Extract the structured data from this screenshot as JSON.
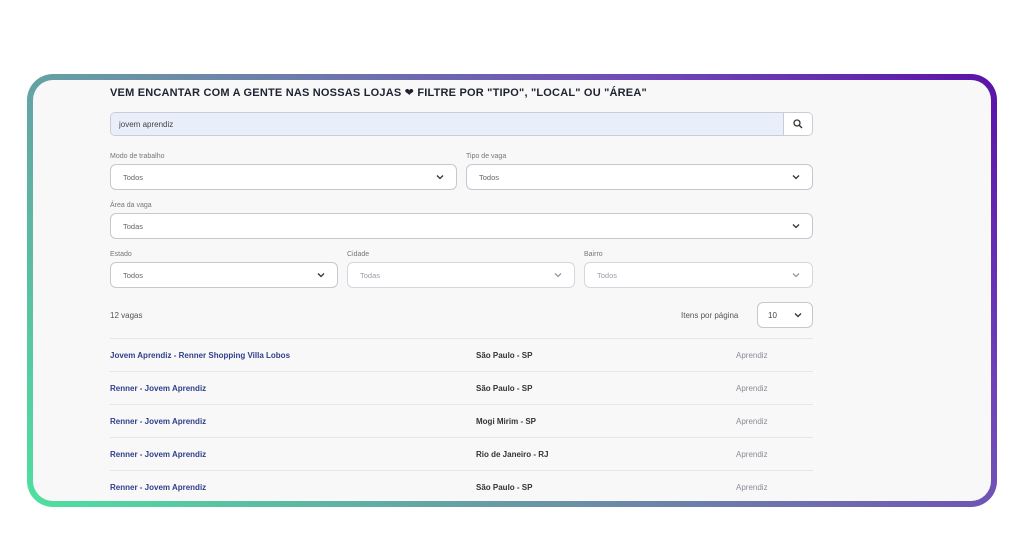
{
  "header": {
    "title_part1": "VEM ENCANTAR COM A GENTE NAS NOSSAS LOJAS",
    "title_part2": "FILTRE POR \"TIPO\", \"LOCAL\" OU \"ÁREA\"",
    "heart_icon": "heart-icon"
  },
  "search": {
    "value": "jovem aprendiz",
    "button_icon": "search-icon"
  },
  "filters": {
    "modo": {
      "label": "Modo de trabalho",
      "value": "Todos"
    },
    "tipo": {
      "label": "Tipo de vaga",
      "value": "Todos"
    },
    "area": {
      "label": "Área da vaga",
      "value": "Todas"
    },
    "estado": {
      "label": "Estado",
      "value": "Todos"
    },
    "cidade": {
      "label": "Cidade",
      "value": "Todas"
    },
    "bairro": {
      "label": "Bairro",
      "value": "Todos"
    }
  },
  "results": {
    "count": "12 vagas",
    "per_page_label": "Itens por página",
    "per_page_value": "10"
  },
  "jobs": [
    {
      "title": "Jovem Aprendiz - Renner Shopping Villa Lobos",
      "location": "São Paulo - SP",
      "type": "Aprendiz"
    },
    {
      "title": "Renner - Jovem Aprendiz",
      "location": "São Paulo - SP",
      "type": "Aprendiz"
    },
    {
      "title": "Renner - Jovem Aprendiz",
      "location": "Mogi Mirim - SP",
      "type": "Aprendiz"
    },
    {
      "title": "Renner - Jovem Aprendiz",
      "location": "Rio de Janeiro - RJ",
      "type": "Aprendiz"
    },
    {
      "title": "Renner - Jovem Aprendiz",
      "location": "São Paulo - SP",
      "type": "Aprendiz"
    }
  ],
  "colors": {
    "gradient_start": "#4fe0a0",
    "gradient_end": "#5a12a8",
    "job_link": "#2f3f8a"
  }
}
